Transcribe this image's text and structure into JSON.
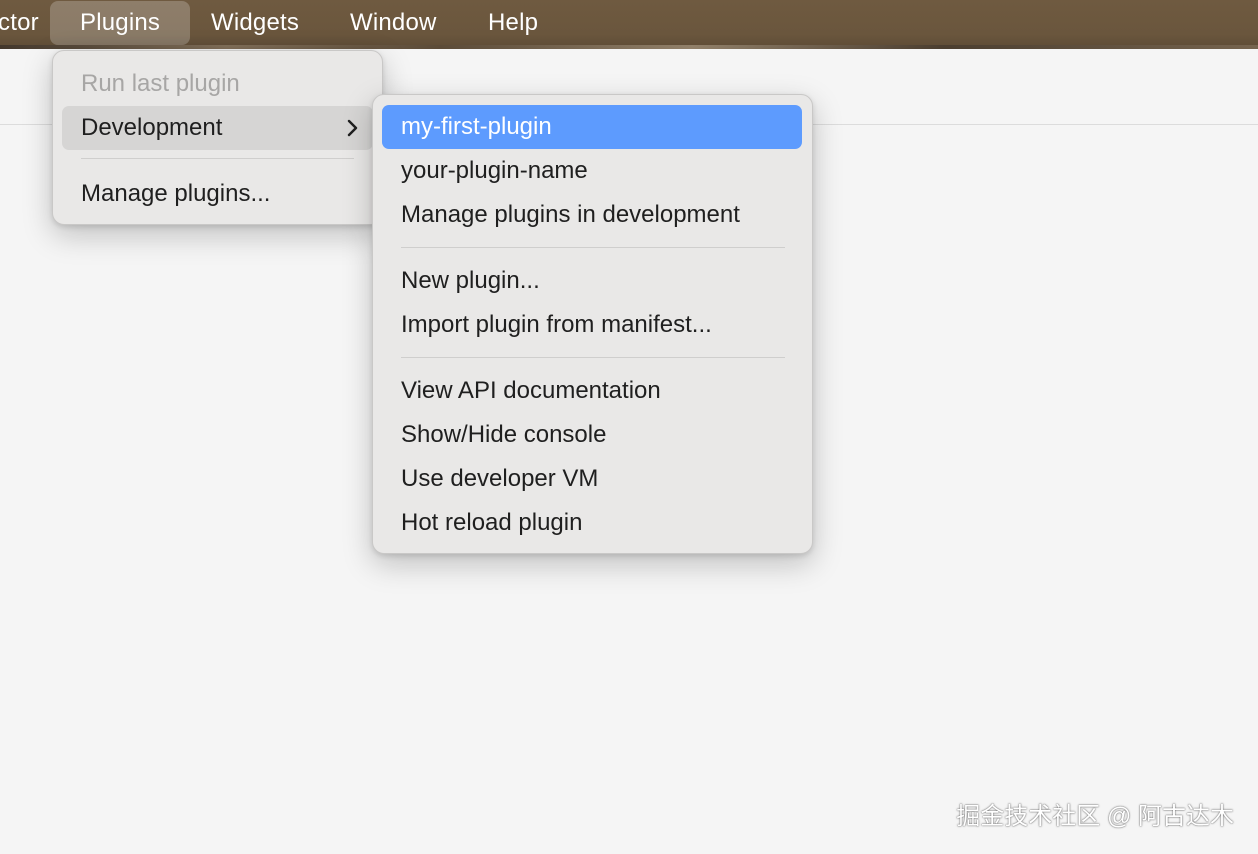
{
  "menubar": {
    "items": [
      {
        "label": "ctor"
      },
      {
        "label": "Plugins"
      },
      {
        "label": "Widgets"
      },
      {
        "label": "Window"
      },
      {
        "label": "Help"
      }
    ]
  },
  "plugins_menu": {
    "run_last": "Run last plugin",
    "development": "Development",
    "manage": "Manage plugins..."
  },
  "development_menu": {
    "items": [
      {
        "label": "my-first-plugin"
      },
      {
        "label": "your-plugin-name"
      },
      {
        "label": "Manage plugins in development"
      },
      {
        "label": "New plugin..."
      },
      {
        "label": "Import plugin from manifest..."
      },
      {
        "label": "View API documentation"
      },
      {
        "label": "Show/Hide console"
      },
      {
        "label": "Use developer VM"
      },
      {
        "label": "Hot reload plugin"
      }
    ]
  },
  "watermark": "掘金技术社区 @ 阿古达木",
  "colors": {
    "selected": "#5d9bfe",
    "menubar": "#6a563d"
  },
  "icons": [
    "chevron-right-icon"
  ]
}
